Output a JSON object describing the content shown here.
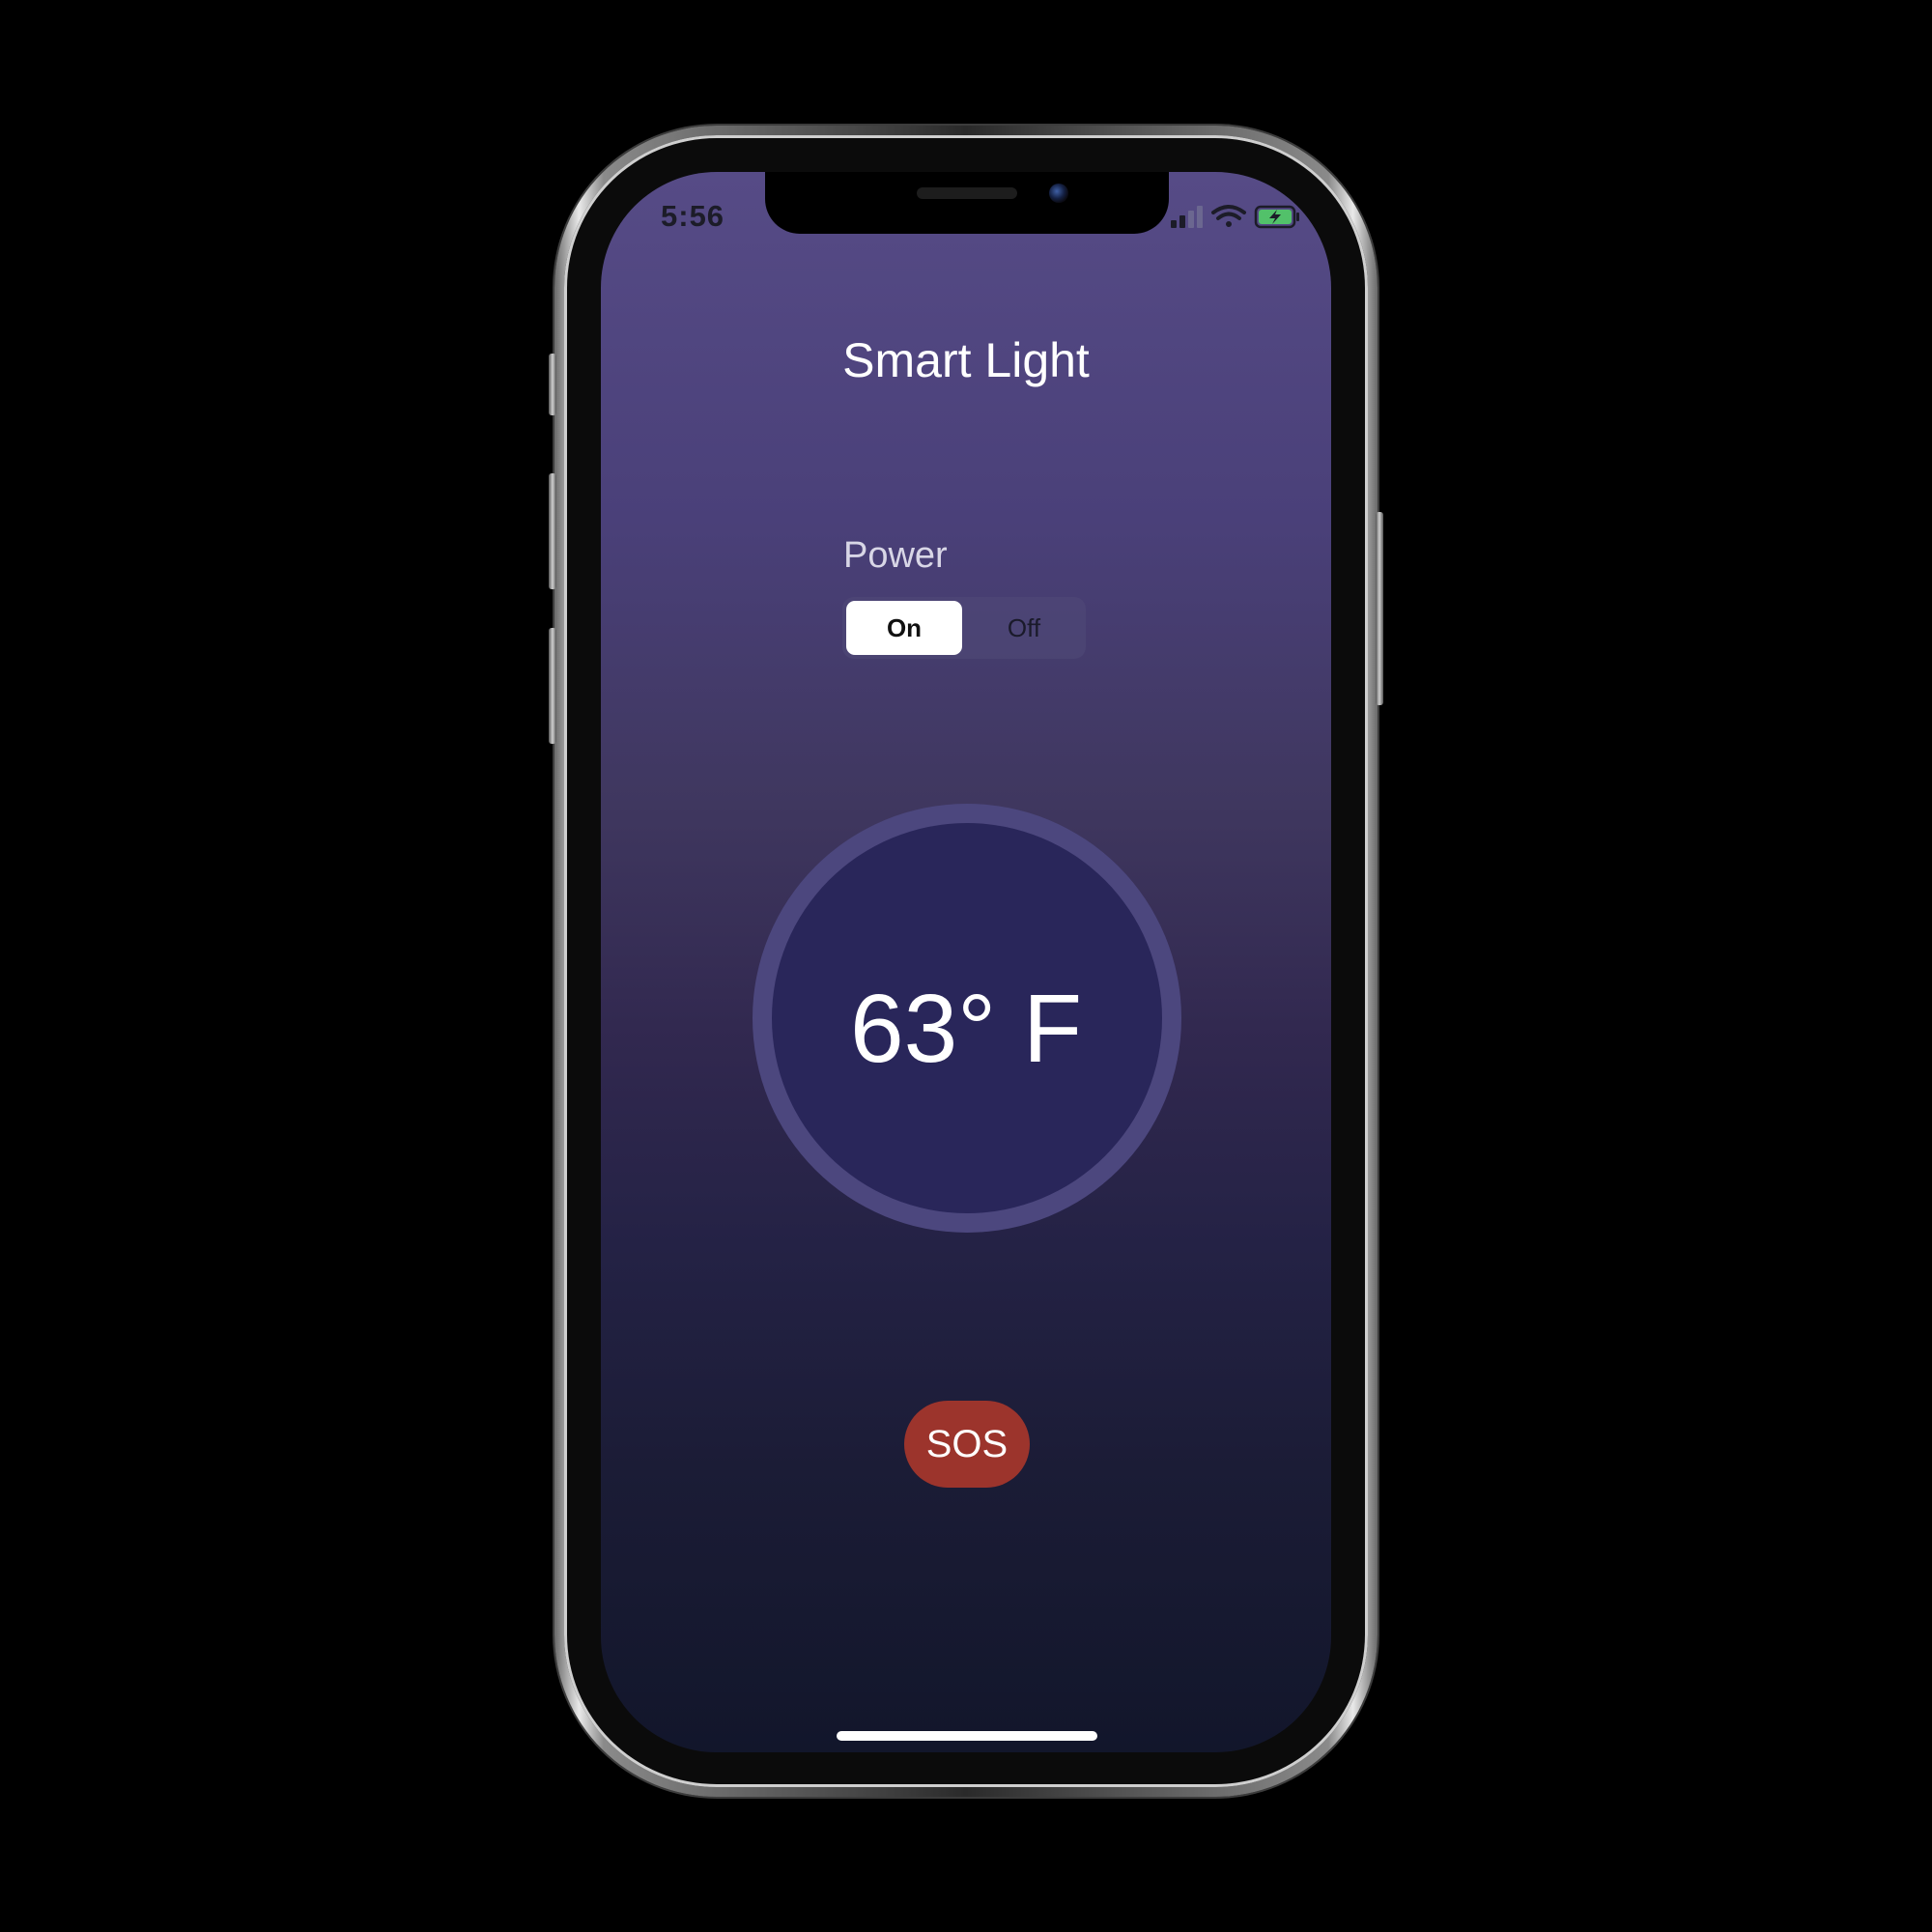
{
  "status_bar": {
    "time": "5:56",
    "icons": [
      "cellular-signal-icon",
      "wifi-icon",
      "battery-charging-icon"
    ]
  },
  "app": {
    "title": "Smart Light"
  },
  "power": {
    "label": "Power",
    "options": [
      "On",
      "Off"
    ],
    "selected": "On"
  },
  "temperature": {
    "display": "63° F"
  },
  "sos_button": {
    "label": "SOS",
    "color": "#9c342c"
  },
  "colors": {
    "gradient_top": "#564b86",
    "gradient_bottom": "#12162b",
    "dial_ring": "#4c477e",
    "dial_fill": "#29265a",
    "battery": "#52c16a"
  }
}
